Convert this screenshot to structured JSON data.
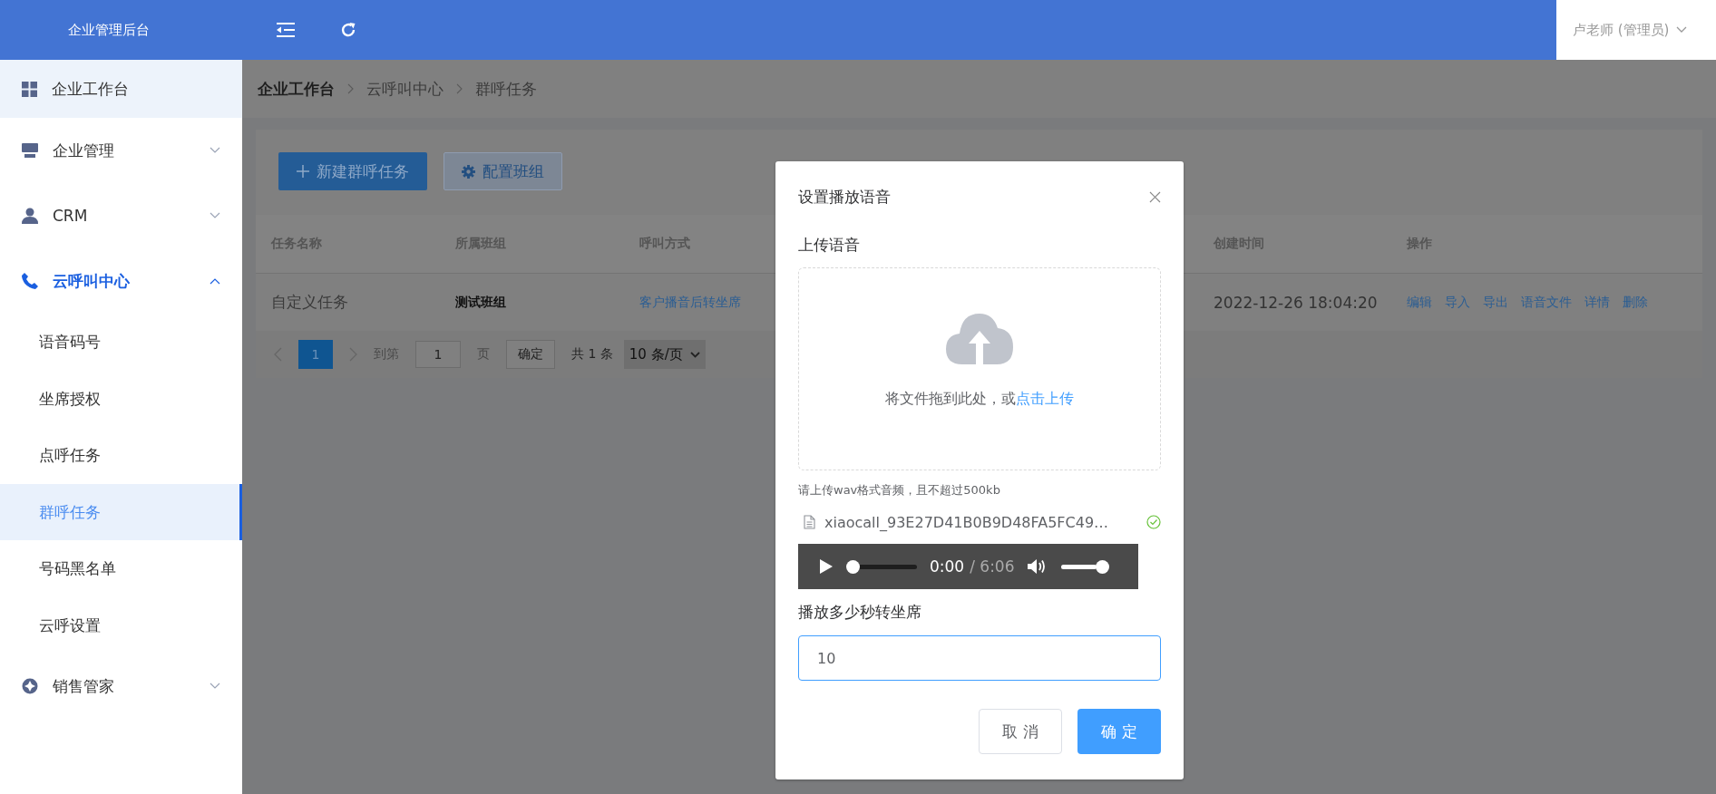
{
  "header": {
    "title": "企业管理后台",
    "user": "卢老师 (管理员)"
  },
  "sidebar": {
    "items": [
      {
        "label": "企业工作台",
        "kind": "link",
        "hovered": true,
        "active": false
      },
      {
        "label": "企业管理",
        "kind": "group",
        "hovered": false,
        "active": false,
        "expanded": false
      },
      {
        "label": "CRM",
        "kind": "group",
        "hovered": false,
        "active": false,
        "expanded": false
      },
      {
        "label": "云呼叫中心",
        "kind": "group",
        "hovered": false,
        "active": true,
        "expanded": true,
        "children": [
          {
            "label": "语音码号",
            "selected": false
          },
          {
            "label": "坐席授权",
            "selected": false
          },
          {
            "label": "点呼任务",
            "selected": false
          },
          {
            "label": "群呼任务",
            "selected": true
          },
          {
            "label": "号码黑名单",
            "selected": false
          },
          {
            "label": "云呼设置",
            "selected": false
          }
        ]
      },
      {
        "label": "销售管家",
        "kind": "group",
        "hovered": false,
        "active": false,
        "expanded": false
      }
    ]
  },
  "breadcrumb": [
    "企业工作台",
    "云呼叫中心",
    "群呼任务"
  ],
  "toolbar": {
    "new_button": "新建群呼任务",
    "config_button": "配置班组"
  },
  "table": {
    "columns": [
      "任务名称",
      "所属班组",
      "呼叫方式",
      "创建时间",
      "操作"
    ],
    "rows": [
      {
        "name": "自定义任务",
        "group": "测试班组",
        "call_mode": "客户播音后转坐席",
        "created": "2022-12-26 18:04:20",
        "actions": [
          "编辑",
          "导入",
          "导出",
          "语音文件",
          "详情",
          "删除"
        ]
      }
    ]
  },
  "pagination": {
    "pages": [
      {
        "label": "1",
        "selected": true
      }
    ],
    "goto_label": "到第",
    "goto_value": "1",
    "page_unit": "页",
    "confirm": "确定",
    "total": "共 1 条",
    "page_size": "10 条/页"
  },
  "dialog": {
    "title": "设置播放语音",
    "upload_label": "上传语音",
    "drop_text": "将文件拖到此处，或",
    "drop_link": "点击上传",
    "hint": "请上传wav格式音频，且不超过500kb",
    "file": {
      "name": "xiaocall_93E27D41B0B9D48FA5FC49…",
      "uploaded": true
    },
    "player": {
      "progress": {
        "level": 0
      },
      "current": "0:00",
      "duration": "/ 6:06",
      "volume": {
        "level": 1
      }
    },
    "seconds_label": "播放多少秒转坐席",
    "seconds_value": "10",
    "buttons": {
      "cancel": "取 消",
      "ok": "确 定"
    }
  }
}
